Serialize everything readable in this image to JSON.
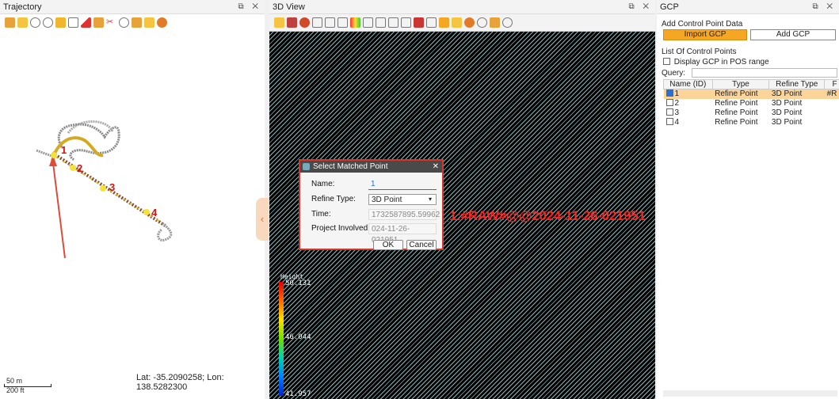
{
  "trajectory": {
    "title": "Trajectory",
    "scale": {
      "top": "50 m",
      "bottom": "200 ft"
    },
    "latlon": "Lat: -35.2090258; Lon: 138.5282300",
    "point_labels": [
      "1",
      "2",
      "3",
      "4"
    ]
  },
  "view3d": {
    "title": "3D View",
    "height_title": "Height",
    "height_values": [
      "50.131",
      "46.044",
      "41.957"
    ],
    "overlay_text": "_1:#RAW#@@2024-11-26-021951",
    "dialog": {
      "title": "Select Matched Point",
      "name_label": "Name:",
      "name_value": "1",
      "refine_type_label": "Refine Type:",
      "refine_type_value": "3D Point",
      "time_label": "Time:",
      "time_value": "1732587895.59962",
      "project_label": "Project Involved:",
      "project_value": "024-11-26-021951",
      "ok": "OK",
      "cancel": "Cancel"
    }
  },
  "gcp": {
    "title": "GCP",
    "add_section": "Add Control Point Data",
    "import_button": "Import GCP",
    "add_button": "Add GCP",
    "list_section": "List Of Control Points",
    "display_checkbox": "Display GCP in POS range",
    "query_label": "Query:",
    "columns": [
      "Name (ID)",
      "Type",
      "Refine Type",
      "F"
    ],
    "rows": [
      {
        "id": "1",
        "type": "Refine Point",
        "refine": "3D Point",
        "extra": "#R",
        "checked": true
      },
      {
        "id": "2",
        "type": "Refine Point",
        "refine": "3D Point",
        "extra": "",
        "checked": false
      },
      {
        "id": "3",
        "type": "Refine Point",
        "refine": "3D Point",
        "extra": "",
        "checked": false
      },
      {
        "id": "4",
        "type": "Refine Point",
        "refine": "3D Point",
        "extra": "",
        "checked": false
      }
    ]
  },
  "panel_controls": "ₓ",
  "colors": {
    "accent": "#f5a623",
    "selected_row": "#fcd49a",
    "dialog_border": "#d9342b",
    "overlay_text": "#ff2222"
  }
}
